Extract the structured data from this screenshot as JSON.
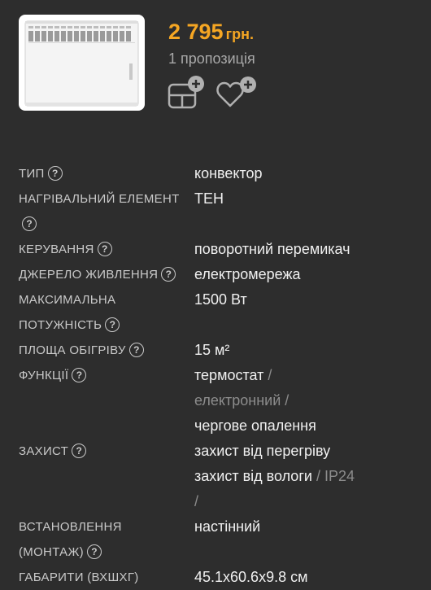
{
  "product": {
    "price": "2 795",
    "currency": "грн.",
    "offers": "1 пропозиція",
    "actions": {
      "compare_icon": "add-to-compare-icon",
      "favorite_icon": "add-to-favorites-icon"
    },
    "image_alt": "electric-convector-heater-icon"
  },
  "specs": [
    {
      "label": "ТИП",
      "value": "конвектор"
    },
    {
      "label": "НАГРІВАЛЬНИЙ ЕЛЕМЕНТ",
      "value": "ТЕН"
    },
    {
      "label": "КЕРУВАННЯ",
      "value": "поворотний перемикач"
    },
    {
      "label": "ДЖЕРЕЛО ЖИВЛЕННЯ",
      "value": "електромережа"
    },
    {
      "label_line1": "МАКСИМАЛЬНА",
      "label_line2": "ПОТУЖНІСТЬ",
      "value": "1500 Вт"
    },
    {
      "label": "ПЛОЩА ОБІГРІВУ",
      "value": "15 м²"
    },
    {
      "label": "ФУНКЦІЇ",
      "values": [
        "термостат",
        "електронний",
        "чергове опалення"
      ]
    },
    {
      "label": "ЗАХИСТ",
      "values": [
        "захист від перегріву",
        "захист від вологи",
        "IP24"
      ]
    },
    {
      "label_line1": "ВСТАНОВЛЕННЯ",
      "label_line2": "(МОНТАЖ)",
      "value": "настінний"
    },
    {
      "label": "ГАБАРИТИ (ВХШХГ)",
      "value": "45.1x60.6x9.8 см"
    }
  ],
  "help_glyph": "?",
  "separator": "/",
  "colors": {
    "background": "#2d2d2d",
    "price": "#f5a623",
    "muted": "#8c8c8c",
    "text": "#f0f0f0"
  }
}
